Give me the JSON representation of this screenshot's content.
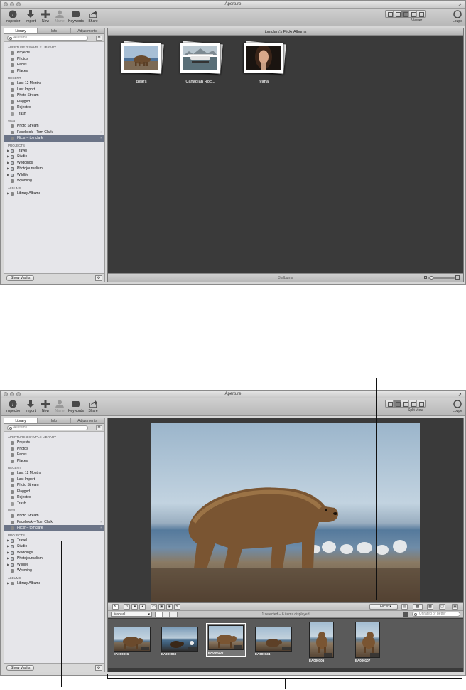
{
  "app_title": "Aperture",
  "toolbar": {
    "inspector": "Inspector",
    "import": "Import",
    "new": "New",
    "name": "Name",
    "keywords": "Keywords",
    "share": "Share",
    "loupe": "Loupe"
  },
  "window1": {
    "view_label": "Viewer",
    "tabs": [
      "Library",
      "Info",
      "Adjustments"
    ],
    "search_placeholder": "All Items",
    "browser_title": "tomclark's Flickr Albums",
    "albums": [
      {
        "name": "Bears"
      },
      {
        "name": "Canadian Roc..."
      },
      {
        "name": "Ivana"
      }
    ],
    "status": "3 albums"
  },
  "window2": {
    "view_label": "Split View",
    "tabs": [
      "Library",
      "Info",
      "Adjustments"
    ],
    "search_placeholder": "All Items",
    "flickr_label": "Flickr",
    "sort_label": "Manual",
    "selection_status": "1 selected – 6 items displayed",
    "filter_placeholder": "Unrated or better",
    "thumbnails": [
      "EA000006",
      "EA000069",
      "EA000100",
      "EA000134",
      "EA000106",
      "EA000107"
    ]
  },
  "sidebar": {
    "library_header": "APERTURE 3 SAMPLE LIBRARY",
    "library_items": [
      "Projects",
      "Photos",
      "Faces",
      "Places"
    ],
    "recent_header": "RECENT",
    "recent_items": [
      "Last 12 Months",
      "Last Import",
      "Photo Stream",
      "Flagged",
      "Rejected",
      "Trash"
    ],
    "web_header": "WEB",
    "web_items": [
      "Photo Stream",
      "Facebook – Tom Clark",
      "Flickr – tomclark"
    ],
    "projects_header": "PROJECTS",
    "projects_items": [
      "Travel",
      "Studio",
      "Weddings",
      "Photojournalism",
      "Wildlife",
      "Wyoming"
    ],
    "albums_header": "ALBUMS",
    "albums_items": [
      "Library Albums"
    ],
    "show_vaults": "Show Vaults"
  }
}
